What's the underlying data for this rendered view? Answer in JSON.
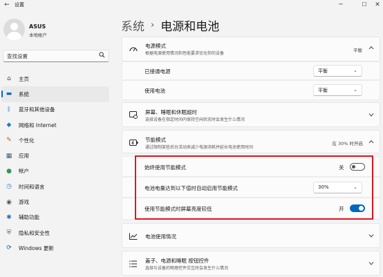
{
  "window": {
    "title": "设置",
    "back_glyph": "←",
    "minimize_glyph": "─",
    "maximize_glyph": "☐",
    "close_glyph": "✕"
  },
  "profile": {
    "name": "ASUS",
    "account_type": "本地帐户"
  },
  "search": {
    "placeholder": "查找设置",
    "icon": "search-icon"
  },
  "sidebar": {
    "items": [
      {
        "label": "主页",
        "icon": "home-icon",
        "glyph": "⌂",
        "color": "#444444",
        "active": false
      },
      {
        "label": "系统",
        "icon": "system-icon",
        "glyph": "▬",
        "color": "#0067c0",
        "active": true
      },
      {
        "label": "蓝牙和其他设备",
        "icon": "bluetooth-icon",
        "glyph": "ᛒ",
        "color": "#0067c0",
        "active": false
      },
      {
        "label": "网络和 Internet",
        "icon": "network-icon",
        "glyph": "◆",
        "color": "#2a78c8",
        "active": false
      },
      {
        "label": "个性化",
        "icon": "personalization-icon",
        "glyph": "✎",
        "color": "#c25a1e",
        "active": false
      },
      {
        "label": "应用",
        "icon": "apps-icon",
        "glyph": "▦",
        "color": "#3d5a80",
        "active": false
      },
      {
        "label": "帐户",
        "icon": "accounts-icon",
        "glyph": "●",
        "color": "#2e9b4f",
        "active": false
      },
      {
        "label": "时间和语言",
        "icon": "time-language-icon",
        "glyph": "◷",
        "color": "#2a78c8",
        "active": false
      },
      {
        "label": "游戏",
        "icon": "gaming-icon",
        "glyph": "◉",
        "color": "#555555",
        "active": false
      },
      {
        "label": "辅助功能",
        "icon": "accessibility-icon",
        "glyph": "✱",
        "color": "#1e6fbf",
        "active": false
      },
      {
        "label": "隐私和安全性",
        "icon": "privacy-shield-icon",
        "glyph": "⛨",
        "color": "#5a5a5a",
        "active": false
      },
      {
        "label": "Windows 更新",
        "icon": "windows-update-icon",
        "glyph": "⟳",
        "color": "#0067c0",
        "active": false
      }
    ]
  },
  "breadcrumb": {
    "parent": "系统",
    "separator": "›",
    "current": "电源和电池"
  },
  "power_mode": {
    "title": "电源模式",
    "description": "根据电源使用情况和性能要求优化你的设备",
    "value": "平衡",
    "icon": "power-mode-icon",
    "rows": [
      {
        "label": "已接通电源",
        "value": "平衡"
      },
      {
        "label": "使用电池",
        "value": "平衡"
      }
    ]
  },
  "screen_sleep": {
    "title": "屏幕、睡眠和休眠超时",
    "description": "选择设备在指定时间内保持空闲状态时会发生什么情况",
    "icon": "screen-sleep-icon"
  },
  "energy_saver": {
    "title": "节能模式",
    "description": "通过限制某些后台活动来减少电源消耗并延长电池使用时间",
    "status": "在 30% 时开启",
    "icon": "energy-saver-icon",
    "always_on": {
      "label": "始终使用节能模式",
      "state_text": "关",
      "on": false
    },
    "threshold": {
      "label": "电池电量达到以下值时自动启用节能模式",
      "value": "30%"
    },
    "lower_brightness": {
      "label": "使用节能模式时屏幕亮度较低",
      "state_text": "开",
      "on": true
    }
  },
  "battery_usage": {
    "title": "电池使用情况",
    "icon": "battery-usage-icon"
  },
  "lid_power": {
    "title": "盖子、电源和睡眠 按钮控件",
    "description": "选择与设备的物理控件交互时会发生什么情况",
    "icon": "lid-controls-icon"
  },
  "colors": {
    "accent": "#0067c0",
    "highlight_box": "#e0141e"
  }
}
